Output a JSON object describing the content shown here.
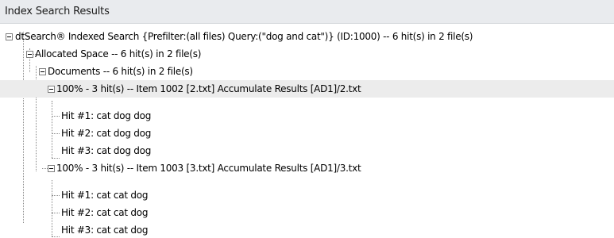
{
  "panel": {
    "title": "Index Search Results"
  },
  "tree": {
    "root": {
      "label": "dtSearch® Indexed Search {Prefilter:(all files) Query:(\"dog and cat\")} (ID:1000) -- 6 hit(s) in 2 file(s)",
      "expanded": true
    },
    "allocated": {
      "label": "Allocated Space -- 6 hit(s) in 2 file(s)",
      "expanded": true
    },
    "documents": {
      "label": "Documents  -- 6 hit(s) in 2 file(s)",
      "expanded": true
    },
    "items": [
      {
        "label": "100% - 3 hit(s) -- Item 1002 [2.txt] Accumulate Results [AD1]/2.txt",
        "expanded": true,
        "selected": true,
        "hits": [
          "Hit #1: cat  dog  dog",
          "Hit #2: cat  dog  dog",
          "Hit #3: cat  dog  dog"
        ]
      },
      {
        "label": "100% - 3 hit(s) -- Item 1003 [3.txt] Accumulate Results [AD1]/3.txt",
        "expanded": true,
        "selected": false,
        "hits": [
          "Hit #1: cat  cat  dog",
          "Hit #2: cat  cat  dog",
          "Hit #3: cat  cat  dog"
        ]
      }
    ]
  },
  "colors": {
    "header_background": "#e9ebee",
    "selected_row": "#ececec",
    "tree_lines": "#8a8a8a"
  }
}
